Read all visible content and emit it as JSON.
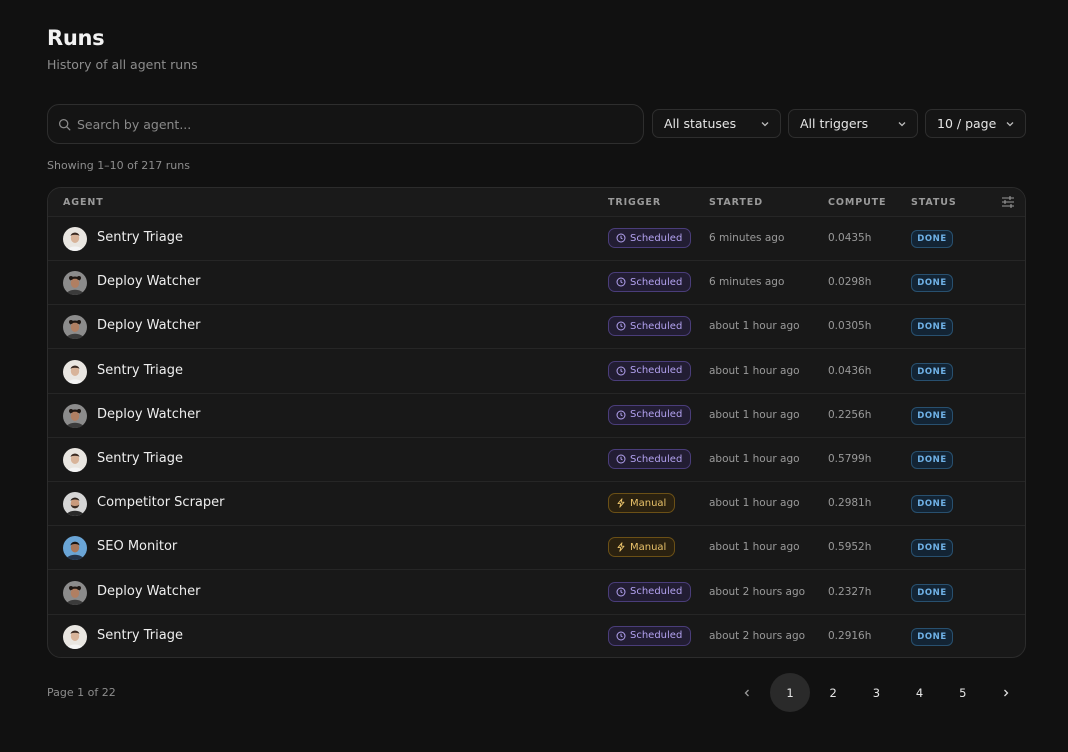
{
  "header": {
    "title": "Runs",
    "subtitle": "History of all agent runs"
  },
  "filters": {
    "search_placeholder": "Search by agent...",
    "status": "All statuses",
    "trigger": "All triggers",
    "page_size": "10 / page"
  },
  "summary": "Showing 1–10 of 217 runs",
  "table": {
    "columns": {
      "agent": "AGENT",
      "trigger": "TRIGGER",
      "started": "STARTED",
      "compute": "COMPUTE",
      "status": "STATUS"
    },
    "rows": [
      {
        "agent": "Sentry Triage",
        "avatar": "man-light",
        "trigger": "Scheduled",
        "trigger_icon": "clock-icon",
        "started": "6 minutes ago",
        "compute": "0.0435h",
        "status": "DONE"
      },
      {
        "agent": "Deploy Watcher",
        "avatar": "man-curly",
        "trigger": "Scheduled",
        "trigger_icon": "clock-icon",
        "started": "6 minutes ago",
        "compute": "0.0298h",
        "status": "DONE"
      },
      {
        "agent": "Deploy Watcher",
        "avatar": "man-curly",
        "trigger": "Scheduled",
        "trigger_icon": "clock-icon",
        "started": "about 1 hour ago",
        "compute": "0.0305h",
        "status": "DONE"
      },
      {
        "agent": "Sentry Triage",
        "avatar": "man-light",
        "trigger": "Scheduled",
        "trigger_icon": "clock-icon",
        "started": "about 1 hour ago",
        "compute": "0.0436h",
        "status": "DONE"
      },
      {
        "agent": "Deploy Watcher",
        "avatar": "man-curly",
        "trigger": "Scheduled",
        "trigger_icon": "clock-icon",
        "started": "about 1 hour ago",
        "compute": "0.2256h",
        "status": "DONE"
      },
      {
        "agent": "Sentry Triage",
        "avatar": "man-light",
        "trigger": "Scheduled",
        "trigger_icon": "clock-icon",
        "started": "about 1 hour ago",
        "compute": "0.5799h",
        "status": "DONE"
      },
      {
        "agent": "Competitor Scraper",
        "avatar": "man-beard",
        "trigger": "Manual",
        "trigger_icon": "bolt-icon",
        "started": "about 1 hour ago",
        "compute": "0.2981h",
        "status": "DONE"
      },
      {
        "agent": "SEO Monitor",
        "avatar": "man-blue",
        "trigger": "Manual",
        "trigger_icon": "bolt-icon",
        "started": "about 1 hour ago",
        "compute": "0.5952h",
        "status": "DONE"
      },
      {
        "agent": "Deploy Watcher",
        "avatar": "man-curly",
        "trigger": "Scheduled",
        "trigger_icon": "clock-icon",
        "started": "about 2 hours ago",
        "compute": "0.2327h",
        "status": "DONE"
      },
      {
        "agent": "Sentry Triage",
        "avatar": "man-light",
        "trigger": "Scheduled",
        "trigger_icon": "clock-icon",
        "started": "about 2 hours ago",
        "compute": "0.2916h",
        "status": "DONE"
      }
    ]
  },
  "pagination": {
    "info": "Page 1 of 22",
    "pages": [
      "1",
      "2",
      "3",
      "4",
      "5"
    ],
    "current": "1"
  },
  "colors": {
    "background": "#111111",
    "scheduled_badge": "#b3a2f0",
    "manual_badge": "#e9c26a",
    "done_badge": "#6fb1e6"
  }
}
